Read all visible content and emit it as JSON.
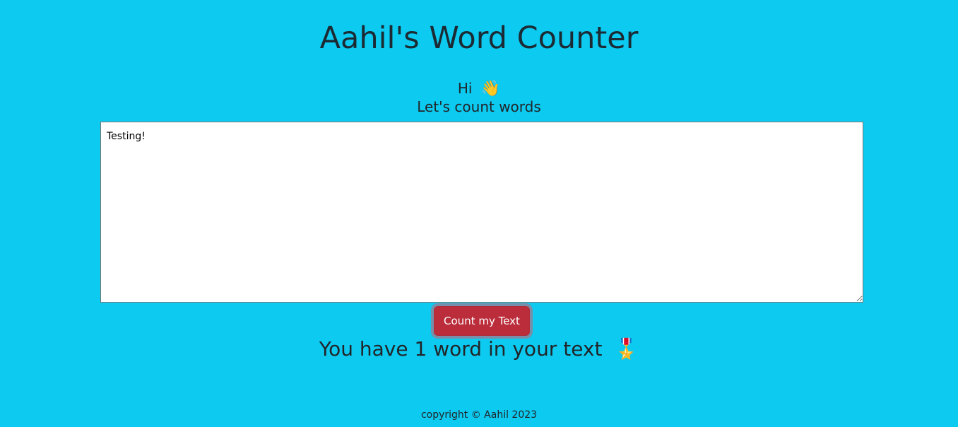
{
  "header": {
    "title": "Aahil's Word Counter"
  },
  "intro": {
    "greeting": "Hi",
    "greeting_icon": "👋",
    "subtitle": "Let's count words"
  },
  "editor": {
    "value": "Testing!"
  },
  "actions": {
    "count_label": "Count my Text"
  },
  "result": {
    "text": "You have 1 word in your text",
    "icon": "🎖️"
  },
  "footer": {
    "text": "copyright © Aahil 2023"
  },
  "colors": {
    "background": "#0dcaf0",
    "button": "#bb2d3b"
  }
}
